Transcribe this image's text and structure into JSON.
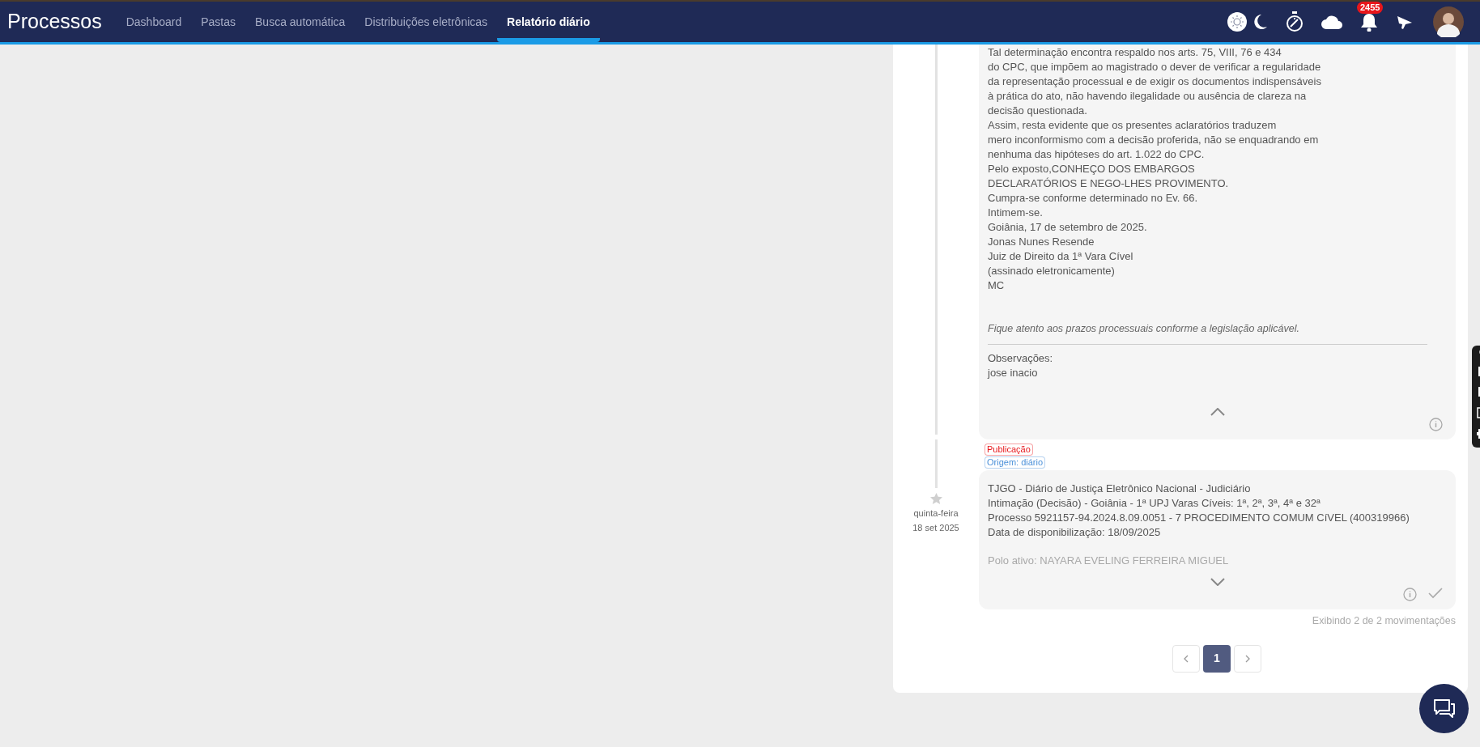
{
  "brand": "Processos",
  "nav_tabs": [
    {
      "label": "Dashboard",
      "selected": false
    },
    {
      "label": "Pastas",
      "selected": false
    },
    {
      "label": "Busca automática",
      "selected": false
    },
    {
      "label": "Distribuições eletrônicas",
      "selected": false
    },
    {
      "label": "Relatório diário",
      "selected": true
    }
  ],
  "notifications": {
    "count": "2455"
  },
  "entries": [
    {
      "lines": [
        "Tal determinação encontra respaldo nos arts. 75, VIII, 76 e 434",
        "do CPC, que impõem ao magistrado o dever de verificar a regularidade",
        "da representação processual e de exigir os documentos indispensáveis",
        "à prática do ato, não havendo ilegalidade ou ausência de clareza na",
        "decisão questionada.",
        "Assim, resta evidente que os presentes aclaratórios traduzem",
        "mero inconformismo com a decisão proferida, não se enquadrando em",
        "nenhuma das hipóteses do art. 1.022 do CPC.",
        "Pelo exposto,CONHEÇO DOS EMBARGOS",
        "DECLARATÓRIOS E NEGO-LHES PROVIMENTO.",
        "Cumpra-se conforme determinado no Ev. 66.",
        "Intimem-se.",
        "Goiânia, 17 de setembro de 2025.",
        "Jonas Nunes Resende",
        "Juiz de Direito da 1ª Vara Cível",
        "(assinado eletronicamente)",
        "MC"
      ],
      "notice": "Fique atento aos prazos processuais conforme a legislação aplicável.",
      "observations_label": "Observações:",
      "observations": "jose inacio",
      "expanded": true,
      "done": false
    },
    {
      "tags": [
        {
          "label": "Publicação",
          "color": "#e8161b"
        },
        {
          "label": "Origem: diário",
          "color": "#4a90d9"
        }
      ],
      "weekday": "quinta-feira",
      "date": "18 set 2025",
      "lines": [
        "TJGO - Diário de Justiça Eletrônico Nacional - Judiciário",
        "Intimação (Decisão) - Goiânia - 1ª UPJ Varas Cíveis: 1ª, 2ª, 3ª, 4ª e 32ª",
        "Processo 5921157-94.2024.8.09.0051 - 7 PROCEDIMENTO COMUM CíVEL (400319966)",
        "Data de disponibilização: 18/09/2025"
      ],
      "faded_line": "Polo ativo: NAYARA EVELING FERREIRA MIGUEL",
      "expanded": false,
      "done": true
    }
  ],
  "footer": "Exibindo 2 de 2 movimentações",
  "pagination": {
    "pages": [
      {
        "label": "1",
        "selected": true
      }
    ]
  }
}
